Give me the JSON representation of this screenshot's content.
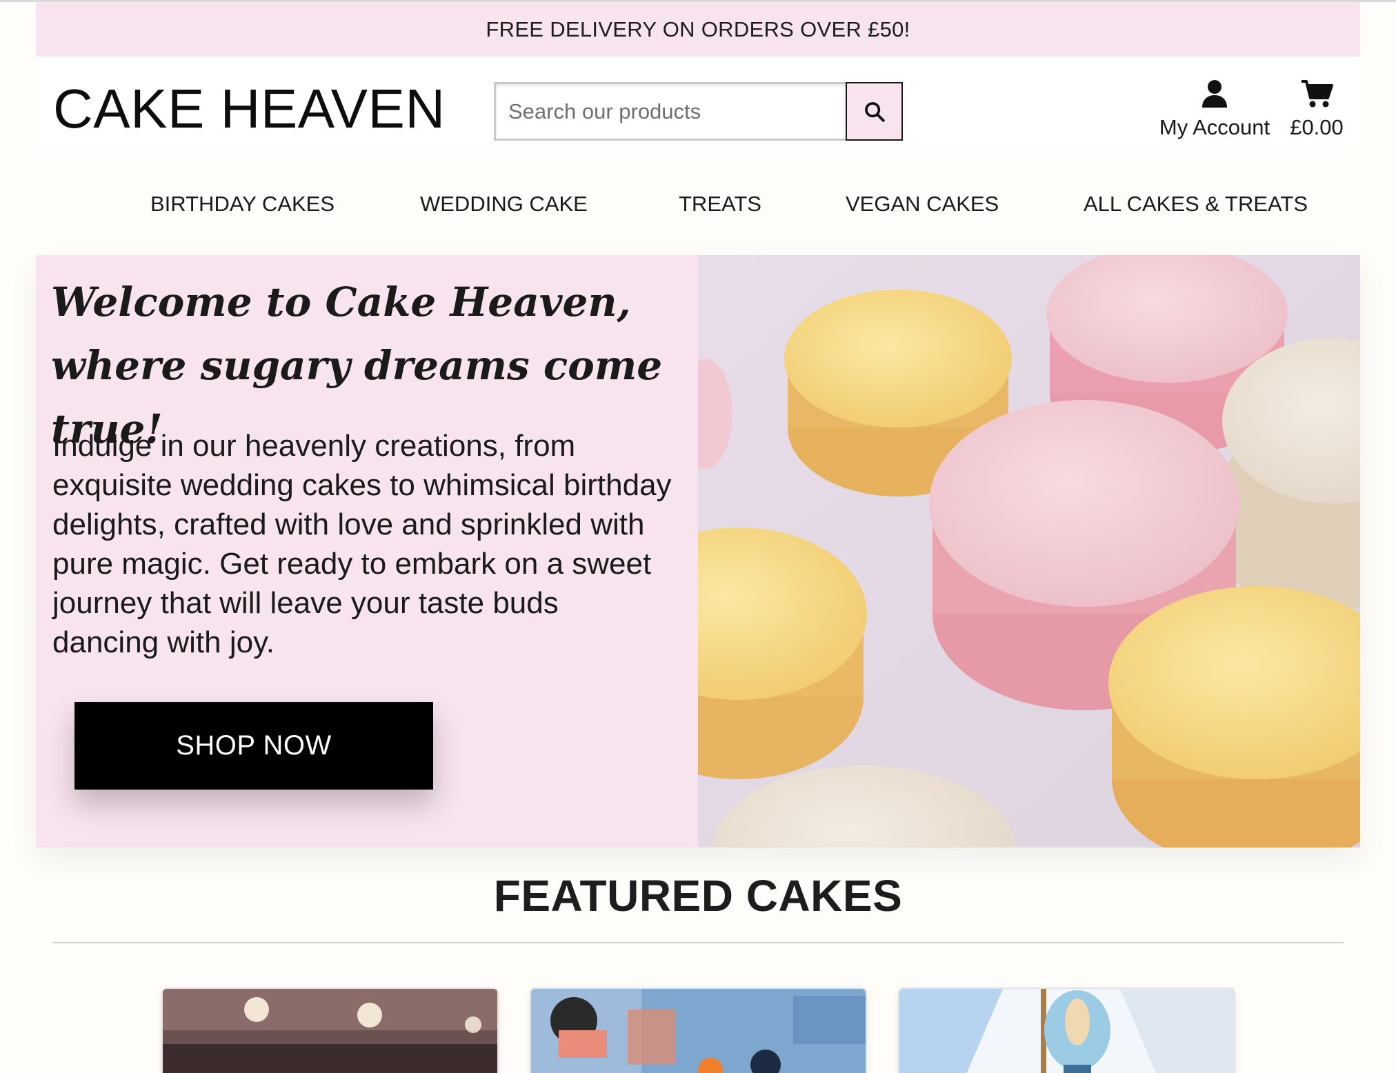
{
  "promo": {
    "text": "FREE DELIVERY ON ORDERS OVER £50!"
  },
  "header": {
    "logo": "CAKE HEAVEN",
    "search_placeholder": "Search our products",
    "account_label": "My Account",
    "cart_total": "£0.00"
  },
  "nav": {
    "items": [
      {
        "label": "BIRTHDAY CAKES"
      },
      {
        "label": "WEDDING CAKE"
      },
      {
        "label": "TREATS"
      },
      {
        "label": "VEGAN CAKES"
      },
      {
        "label": "ALL CAKES & TREATS"
      }
    ]
  },
  "hero": {
    "title": "Welcome to Cake Heaven, where sugary dreams come true!",
    "text": "Indulge in our heavenly creations, from exquisite wedding cakes to whimsical birthday delights, crafted with love and sprinkled with pure magic. Get ready to embark on a sweet journey that will leave your taste buds dancing with joy.",
    "button": "SHOP NOW"
  },
  "featured": {
    "title": "FEATURED CAKES"
  },
  "icons": {
    "search": "search-icon",
    "account": "user-icon",
    "cart": "cart-icon"
  },
  "colors": {
    "accent_pink": "#f8e4ee",
    "button_black": "#000000",
    "page_bg": "#fefdf9"
  }
}
